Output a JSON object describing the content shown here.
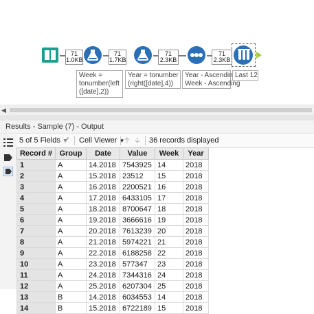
{
  "workflow": {
    "connections": [
      {
        "count": "71",
        "size": "1.0KB"
      },
      {
        "count": "71",
        "size": "1.7KB"
      },
      {
        "count": "71",
        "size": "2.3KB"
      },
      {
        "count": "71",
        "size": "2.3KB"
      }
    ],
    "annotations": {
      "formula_week": "Week =\ntonumber(left\n([date],2))",
      "formula_year": "Year = tonumber\n(right([date],4))",
      "sort": "Year - Ascending\nWeek - Ascending",
      "sample": "Last 12"
    },
    "colors": {
      "input": "#1f9e8f",
      "formula": "#2b6fb7",
      "sort": "#2b6fb7",
      "sample": "#2b6fb7"
    }
  },
  "results": {
    "title": "Results - Sample (7) - Output",
    "fields_label": "5 of 5 Fields",
    "viewer_label": "Cell Viewer",
    "records_label": "36 records displayed",
    "columns": [
      "Record #",
      "Group",
      "Date",
      "Value",
      "Week",
      "Year"
    ],
    "rows": [
      [
        "1",
        "A",
        "14.2018",
        "7543925",
        "14",
        "2018"
      ],
      [
        "2",
        "A",
        "15.2018",
        "23512",
        "15",
        "2018"
      ],
      [
        "3",
        "A",
        "16.2018",
        "2200521",
        "16",
        "2018"
      ],
      [
        "4",
        "A",
        "17.2018",
        "6433105",
        "17",
        "2018"
      ],
      [
        "5",
        "A",
        "18.2018",
        "8700647",
        "18",
        "2018"
      ],
      [
        "6",
        "A",
        "19.2018",
        "3666616",
        "19",
        "2018"
      ],
      [
        "7",
        "A",
        "20.2018",
        "7613239",
        "20",
        "2018"
      ],
      [
        "8",
        "A",
        "21.2018",
        "5974221",
        "21",
        "2018"
      ],
      [
        "9",
        "A",
        "22.2018",
        "6188258",
        "22",
        "2018"
      ],
      [
        "10",
        "A",
        "23.2018",
        "577347",
        "23",
        "2018"
      ],
      [
        "11",
        "A",
        "24.2018",
        "7344316",
        "24",
        "2018"
      ],
      [
        "12",
        "A",
        "25.2018",
        "6207304",
        "25",
        "2018"
      ],
      [
        "13",
        "B",
        "14.2018",
        "6034553",
        "14",
        "2018"
      ],
      [
        "14",
        "B",
        "15.2018",
        "6722189",
        "15",
        "2018"
      ]
    ]
  }
}
